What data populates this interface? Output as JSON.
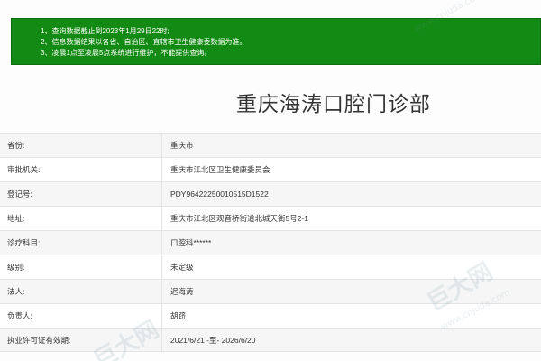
{
  "notice": {
    "lines": [
      "1、查询数据截止到2023年1月29日22时;",
      "2、信息数据结果以各省、自治区、直辖市卫生健康委数据为准。",
      "3、凌晨1点至凌晨5点系统进行维护，不能提供查询。"
    ],
    "background_color": "#138a13"
  },
  "title": "重庆海涛口腔门诊部",
  "rows": [
    {
      "label": "省份:",
      "value": "重庆市"
    },
    {
      "label": "审批机关:",
      "value": "重庆市江北区卫生健康委员会"
    },
    {
      "label": "登记号:",
      "value": "PDY96422250010515D1522"
    },
    {
      "label": "地址:",
      "value": "重庆市江北区观音桥街道北城天街5号2-1"
    },
    {
      "label": "诊疗科目:",
      "value": "口腔科******"
    },
    {
      "label": "级别:",
      "value": "未定级"
    },
    {
      "label": "法人:",
      "value": "迟海涛"
    },
    {
      "label": "负责人:",
      "value": "胡跻"
    },
    {
      "label": "执业许可证有效期:",
      "value": "2021/6/21 -至- 2026/6/20"
    }
  ],
  "watermark": {
    "brand": "巨大网",
    "url": "www.cnjuda.com"
  }
}
